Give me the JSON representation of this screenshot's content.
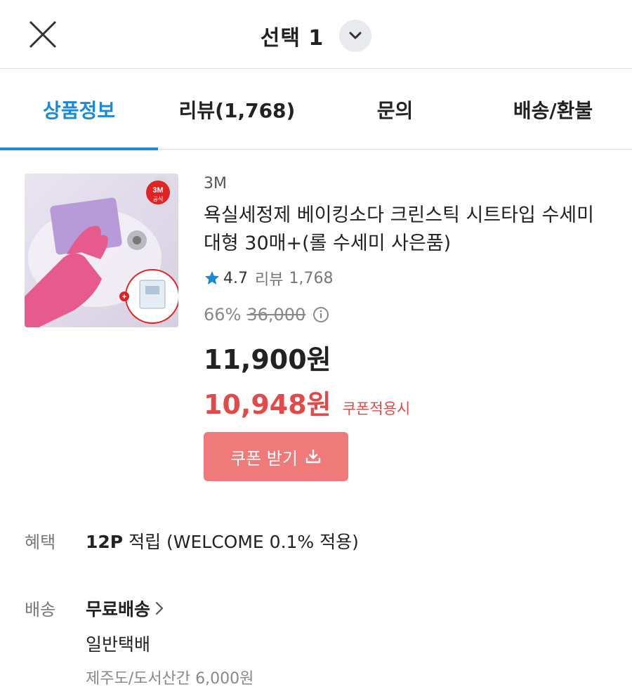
{
  "header": {
    "title": "선택 1",
    "close_icon": "close-icon",
    "dropdown_icon": "chevron-down-icon"
  },
  "tabs": [
    {
      "label": "상품정보",
      "active": true
    },
    {
      "label": "리뷰(1,768)",
      "active": false
    },
    {
      "label": "문의",
      "active": false
    },
    {
      "label": "배송/환불",
      "active": false
    }
  ],
  "product": {
    "brand": "3M",
    "name": "욕실세정제 베이킹소다 크린스틱 시트타입 수세미 대형 30매+(롤 수세미 사은품)",
    "badge": "3M",
    "badge_sub": "공식",
    "rating": "4.7",
    "review_label": "리뷰",
    "review_count": "1,768",
    "discount_rate": "66%",
    "original_price": "36,000",
    "price": "11,900원",
    "coupon_price": "10,948원",
    "coupon_note": "쿠폰적용시",
    "coupon_button": "쿠폰 받기"
  },
  "benefit": {
    "label": "혜택",
    "points": "12P",
    "text": "적립 (WELCOME 0.1% 적용)"
  },
  "shipping": {
    "label": "배송",
    "value": "무료배송",
    "method": "일반택배",
    "extra": "제주도/도서산간 6,000원"
  },
  "colors": {
    "accent": "#1a8ad6",
    "sale": "#e24a4a",
    "coupon_btn": "#f07a7a",
    "star": "#1a8ad6"
  }
}
